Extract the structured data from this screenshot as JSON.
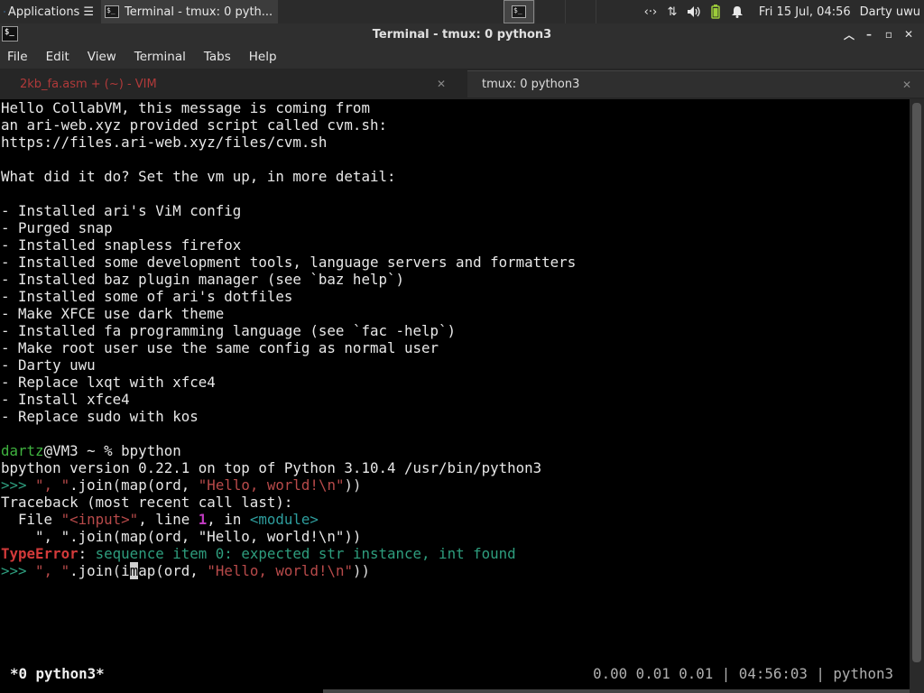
{
  "panel": {
    "applications_label": "Applications",
    "task_label": "Terminal - tmux: 0 pyth...",
    "clock": "Fri 15 Jul, 04:56",
    "user": "Darty uwu",
    "tray_icons": [
      "network-icon",
      "transfer-icon",
      "volume-icon",
      "battery-icon",
      "notification-icon"
    ]
  },
  "window": {
    "title": "Terminal - tmux: 0 python3"
  },
  "menubar": {
    "items": [
      "File",
      "Edit",
      "View",
      "Terminal",
      "Tabs",
      "Help"
    ]
  },
  "tabs": [
    {
      "label": "2kb_fa.asm + (~) - VIM",
      "active": false
    },
    {
      "label": "tmux: 0 python3",
      "active": true
    }
  ],
  "terminal": {
    "message_lines": [
      "Hello CollabVM, this message is coming from",
      "an ari-web.xyz provided script called cvm.sh:",
      "https://files.ari-web.xyz/files/cvm.sh",
      "",
      "What did it do? Set the vm up, in more detail:",
      "",
      "- Installed ari's ViM config",
      "- Purged snap",
      "- Installed snapless firefox",
      "- Installed some development tools, language servers and formatters",
      "- Installed baz plugin manager (see `baz help`)",
      "- Installed some of ari's dotfiles",
      "- Make XFCE use dark theme",
      "- Installed fa programming language (see `fac -help`)",
      "- Make root user use the same config as normal user",
      "- Darty uwu",
      "- Replace lxqt with xfce4",
      "- Install xfce4",
      "- Replace sudo with kos",
      ""
    ],
    "shell_user": "dartz",
    "shell_rest": "@VM3 ~ % bpython",
    "bpython_version": "bpython version 0.22.1 on top of Python 3.10.4 /usr/bin/python3",
    "prompt": ">>> ",
    "cmd1_sep": "\", \"",
    "cmd1_join": ".join",
    "cmd1_open": "(",
    "cmd1_map": "map",
    "cmd1_args": "(ord, ",
    "cmd1_str": "\"Hello, world!\\n\"",
    "cmd1_close": "))",
    "traceback": "Traceback (most recent call last):",
    "file_prefix": "  File ",
    "file_input": "\"<input>\"",
    "file_line": ", line ",
    "file_lineno": "1",
    "file_in": ", in ",
    "file_module": "<module>",
    "source_line": "    \", \".join(map(ord, \"Hello, world!\\n\"))",
    "error_type": "TypeError",
    "error_colon": ": ",
    "error_msg": "sequence item 0: expected str instance, int found",
    "cmd2_before_cursor": "i",
    "cmd2_cursor": "m",
    "cmd2_after_cursor": "ap"
  },
  "tmux": {
    "left": "*0 python3*",
    "right": "0.00 0.01 0.01 | 04:56:03 | python3"
  }
}
